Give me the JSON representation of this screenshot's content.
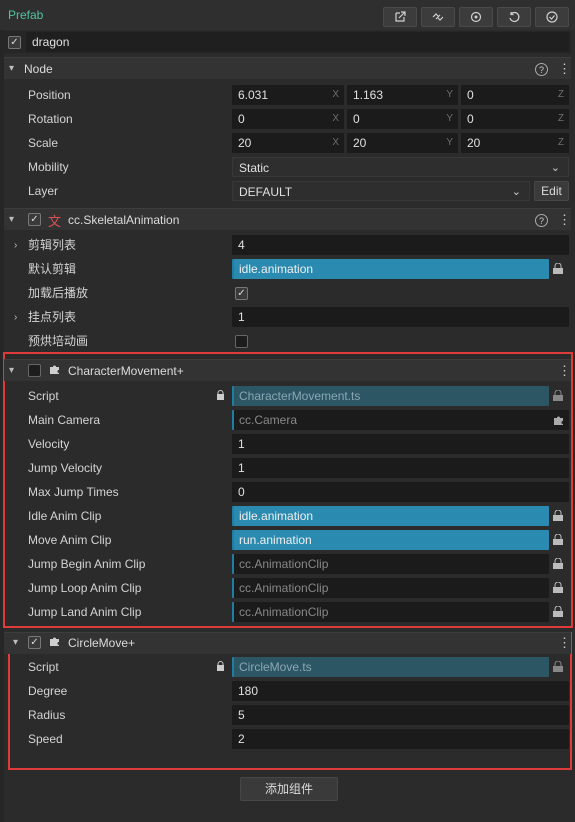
{
  "topbar": {
    "label": "Prefab",
    "buttons": [
      {
        "icon": "open-external-icon"
      },
      {
        "icon": "unlink-icon"
      },
      {
        "icon": "locate-icon"
      },
      {
        "icon": "revert-icon"
      },
      {
        "icon": "apply-icon"
      }
    ]
  },
  "node_name": {
    "enabled": true,
    "value": "dragon"
  },
  "node": {
    "title": "Node",
    "position": {
      "label": "Position",
      "x": "6.031",
      "y": "1.163",
      "z": "0"
    },
    "rotation": {
      "label": "Rotation",
      "x": "0",
      "y": "0",
      "z": "0"
    },
    "scale": {
      "label": "Scale",
      "x": "20",
      "y": "20",
      "z": "20"
    },
    "mobility": {
      "label": "Mobility",
      "value": "Static"
    },
    "layer": {
      "label": "Layer",
      "value": "DEFAULT",
      "edit_label": "Edit"
    },
    "axis": {
      "x": "X",
      "y": "Y",
      "z": "Z"
    }
  },
  "skeletal": {
    "title": "cc.SkeletalAnimation",
    "enabled": true,
    "rows": {
      "clips": {
        "label": "剪辑列表",
        "value": "4"
      },
      "default_clip": {
        "label": "默认剪辑",
        "value": "idle.animation"
      },
      "play_on_load": {
        "label": "加载后播放",
        "checked": true
      },
      "sockets": {
        "label": "挂点列表",
        "value": "1"
      },
      "bake": {
        "label": "预烘培动画",
        "checked": false
      }
    }
  },
  "character": {
    "title": "CharacterMovement+",
    "enabled": false,
    "rows": {
      "script": {
        "label": "Script",
        "value": "CharacterMovement.ts"
      },
      "camera": {
        "label": "Main Camera",
        "value": "cc.Camera"
      },
      "velocity": {
        "label": "Velocity",
        "value": "1"
      },
      "jump_velocity": {
        "label": "Jump Velocity",
        "value": "1"
      },
      "max_jump": {
        "label": "Max Jump Times",
        "value": "0"
      },
      "idle_clip": {
        "label": "Idle Anim Clip",
        "value": "idle.animation"
      },
      "move_clip": {
        "label": "Move Anim Clip",
        "value": "run.animation"
      },
      "jump_begin": {
        "label": "Jump Begin Anim Clip",
        "value": "cc.AnimationClip"
      },
      "jump_loop": {
        "label": "Jump Loop Anim Clip",
        "value": "cc.AnimationClip"
      },
      "jump_land": {
        "label": "Jump Land Anim Clip",
        "value": "cc.AnimationClip"
      }
    }
  },
  "circle": {
    "title": "CircleMove+",
    "enabled": true,
    "rows": {
      "script": {
        "label": "Script",
        "value": "CircleMove.ts"
      },
      "degree": {
        "label": "Degree",
        "value": "180"
      },
      "radius": {
        "label": "Radius",
        "value": "5"
      },
      "speed": {
        "label": "Speed",
        "value": "2"
      }
    }
  },
  "add_component_label": "添加组件",
  "colors": {
    "accent": "#2a8aaf",
    "highlight": "#e03b3b",
    "prefab": "#4fc3a1"
  }
}
